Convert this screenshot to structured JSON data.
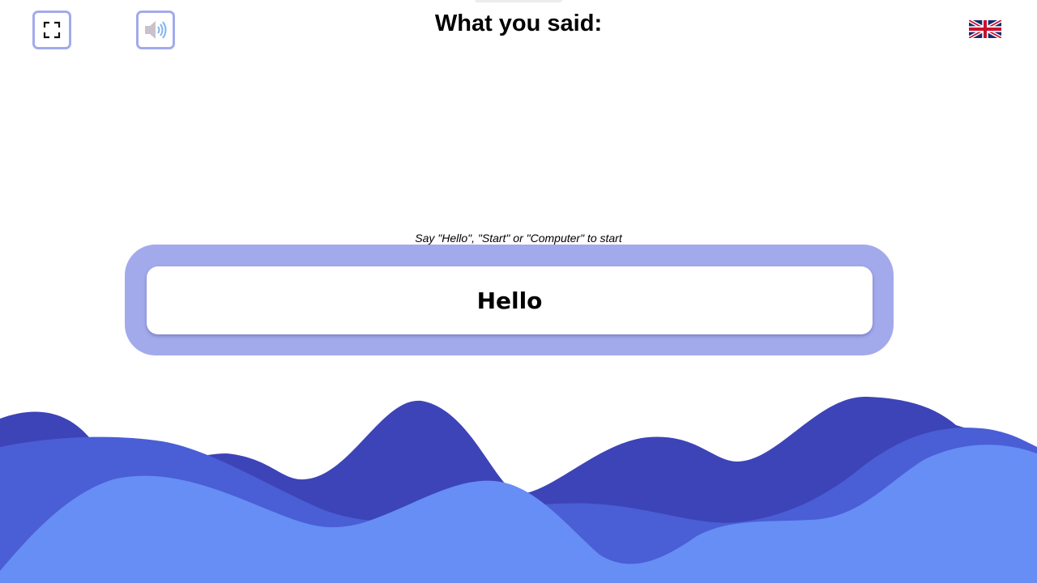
{
  "header": {
    "title": "What you said:",
    "fullscreen_icon": "fullscreen-icon",
    "sound_icon": "speaker-icon",
    "language_icon": "uk-flag-icon"
  },
  "prompt": {
    "hint": "Say \"Hello\", \"Start\" or \"Computer\" to start",
    "recognized_text": "Hello"
  },
  "colors": {
    "accent": "#a3aaeb",
    "wave_dark": "#3d44b8",
    "wave_mid": "#4a5ed6",
    "wave_light": "#668ef4"
  }
}
